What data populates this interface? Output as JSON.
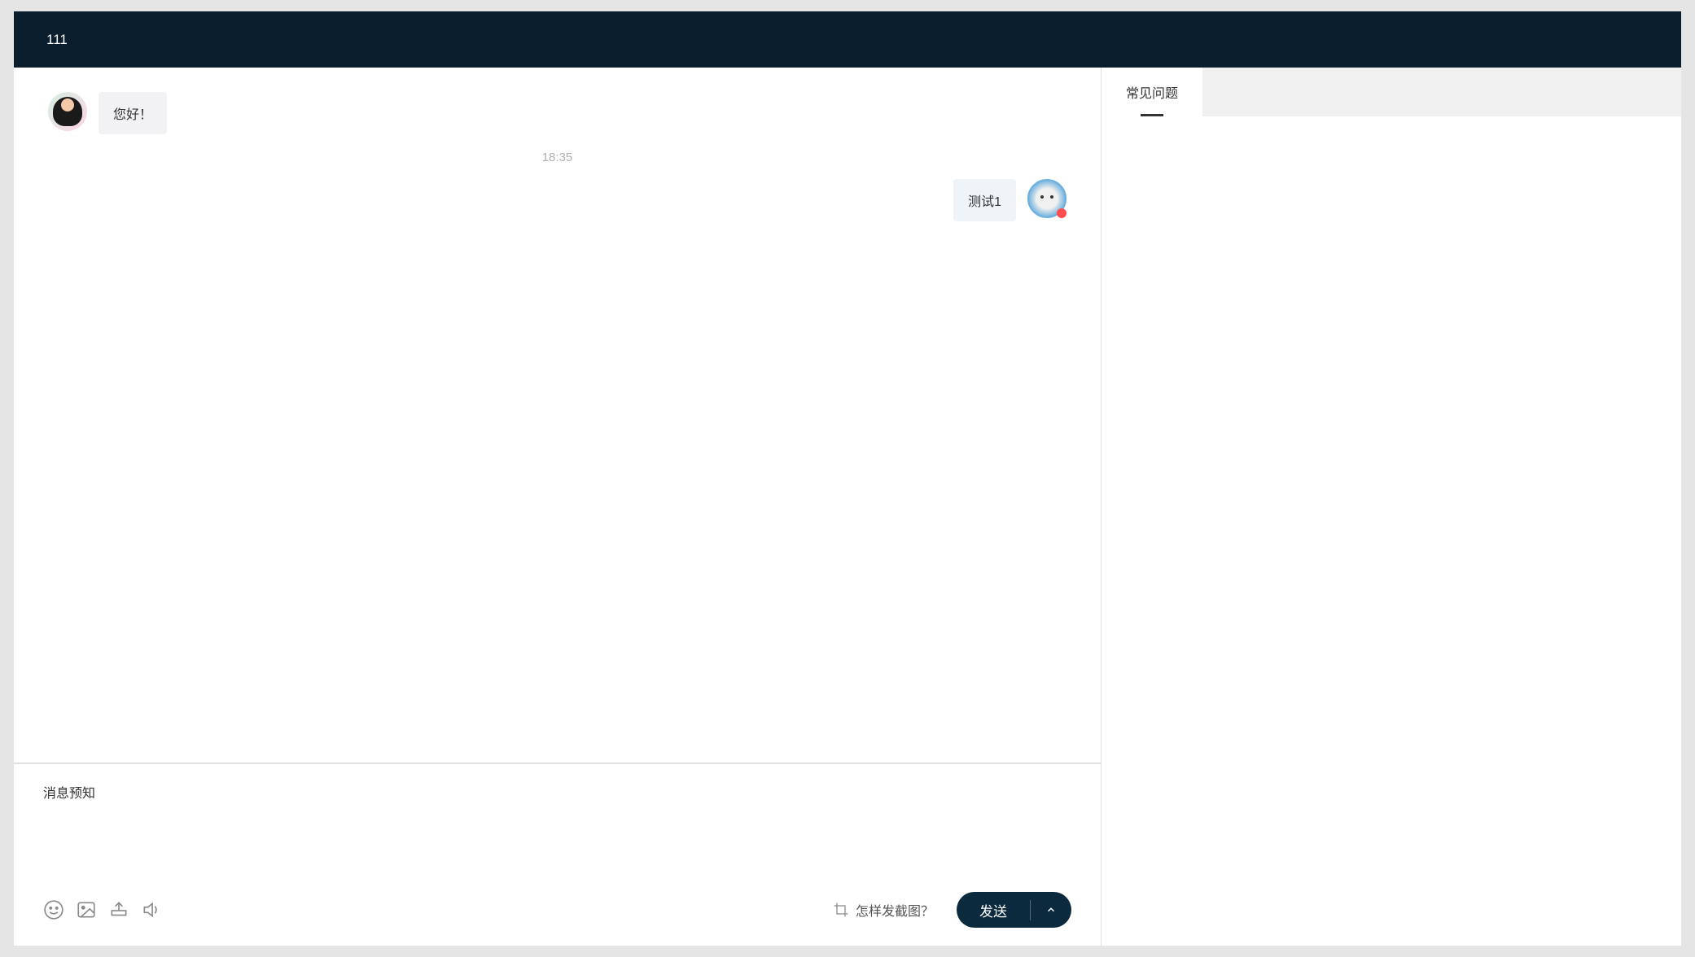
{
  "header": {
    "title": "111"
  },
  "chat": {
    "messages": [
      {
        "type": "agent",
        "text": "您好！"
      }
    ],
    "timestamp": "18:35",
    "user_messages": [
      {
        "text": "测试1"
      }
    ]
  },
  "input": {
    "preview_label": "消息预知",
    "screenshot_hint": "怎样发截图？",
    "send_label": "发送"
  },
  "sidebar": {
    "tabs": [
      {
        "label": "常见问题",
        "active": true
      }
    ]
  }
}
